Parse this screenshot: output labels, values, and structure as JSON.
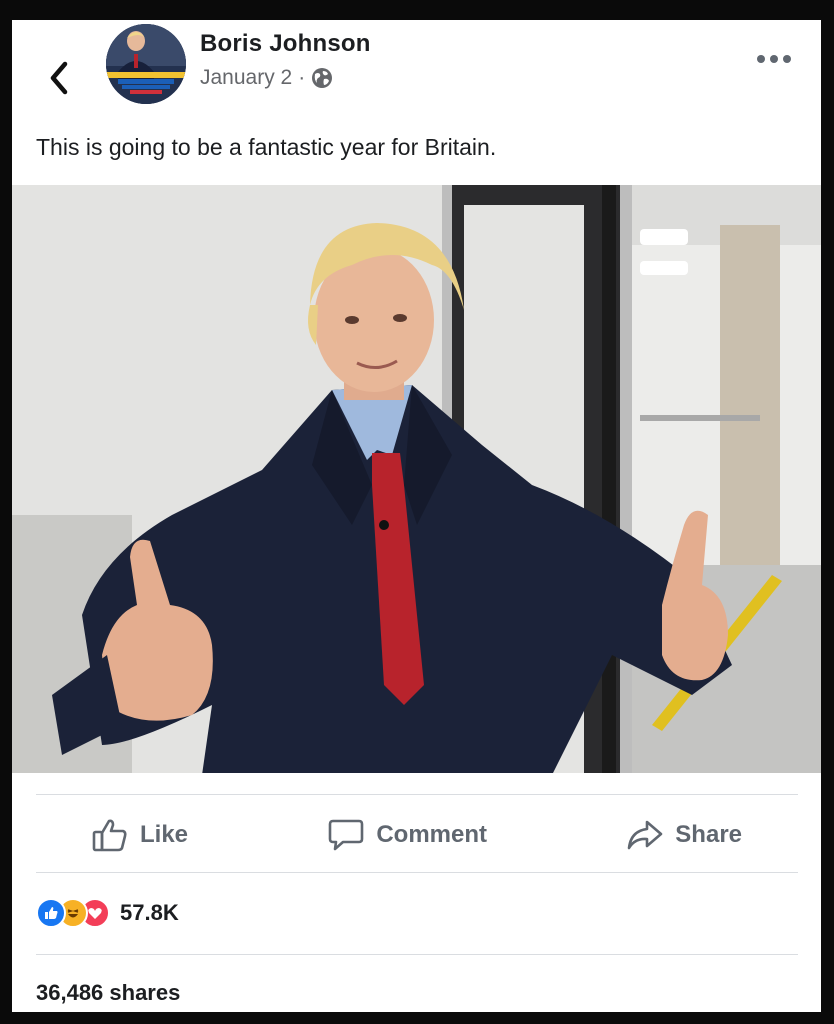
{
  "post": {
    "author": "Boris Johnson",
    "date": "January 2",
    "separator": "·",
    "audience_icon": "globe-icon",
    "text": "This is going to be a fantastic year for Britain."
  },
  "header": {
    "back_icon": "chevron-left-icon",
    "more_icon": "more-horizontal-icon"
  },
  "actions": {
    "like_label": "Like",
    "comment_label": "Comment",
    "share_label": "Share"
  },
  "reactions": {
    "types": [
      "like",
      "haha",
      "love"
    ],
    "count": "57.8K"
  },
  "shares_text": "36,486 shares",
  "colors": {
    "like_blue": "#1877f2",
    "love_red": "#f33e58",
    "haha_yellow": "#f7b125",
    "suit_navy": "#1b2238",
    "tie_red": "#b8232c"
  }
}
